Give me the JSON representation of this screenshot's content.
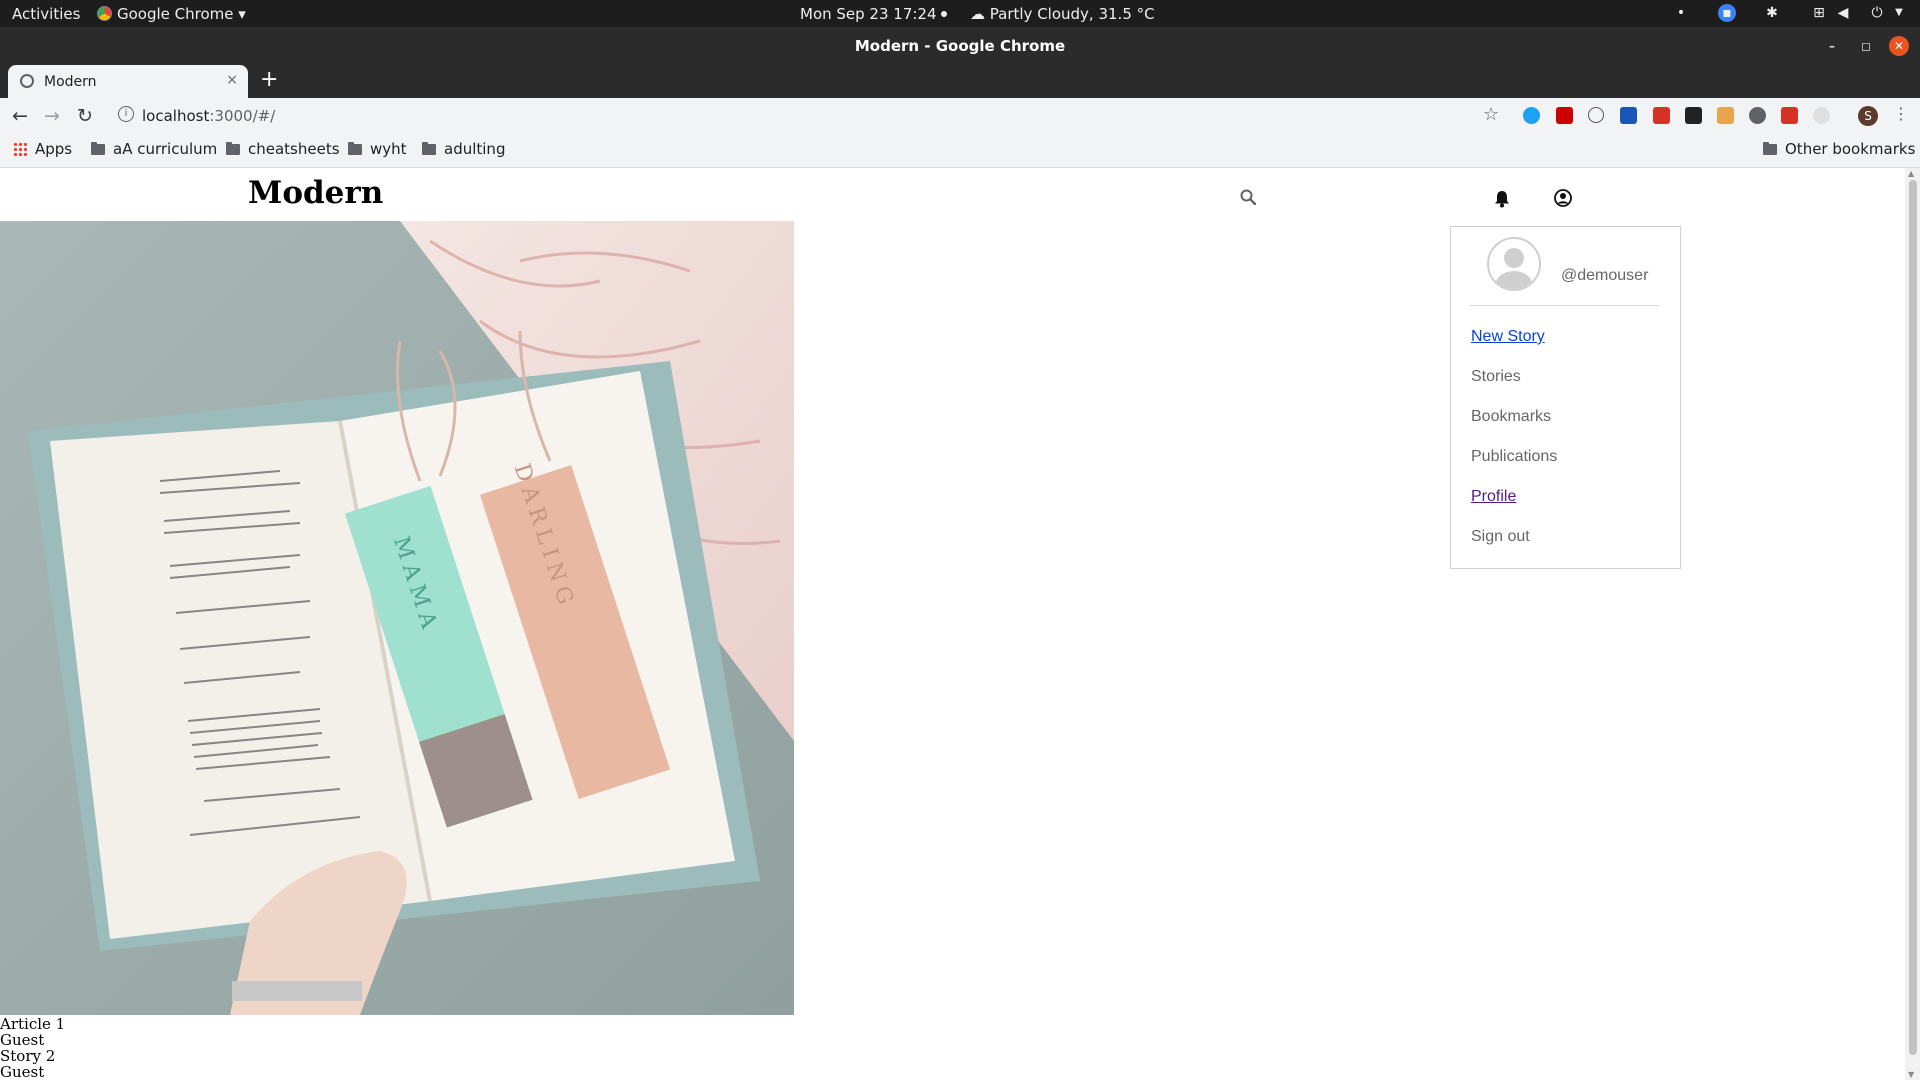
{
  "desktop": {
    "activities": "Activities",
    "app_menu": "Google Chrome ▾",
    "clock": "Mon Sep 23  17:24",
    "weather": "Partly Cloudy, 31.5 °C"
  },
  "browser": {
    "window_title": "Modern - Google Chrome",
    "tab_title": "Modern",
    "tab_close": "×",
    "new_tab": "+",
    "url_host": "localhost",
    "url_rest": ":3000/#/",
    "profile_initial": "S",
    "bookmarks": [
      "Apps",
      "aA curriculum",
      "cheatsheets",
      "wyht",
      "adulting"
    ],
    "other_bookmarks": "Other bookmarks"
  },
  "site": {
    "logo": "Modern",
    "hero_text": {
      "mama": "MAMA",
      "darling": "DARLING"
    },
    "articles": [
      "Article 1",
      "Guest",
      "Story 2",
      "Guest"
    ]
  },
  "dropdown": {
    "username": "@demouser",
    "items": [
      {
        "label": "New Story",
        "style": "link"
      },
      {
        "label": "Stories",
        "style": "plain"
      },
      {
        "label": "Bookmarks",
        "style": "plain"
      },
      {
        "label": "Publications",
        "style": "plain"
      },
      {
        "label": "Profile",
        "style": "visited"
      },
      {
        "label": "Sign out",
        "style": "plain"
      }
    ]
  }
}
